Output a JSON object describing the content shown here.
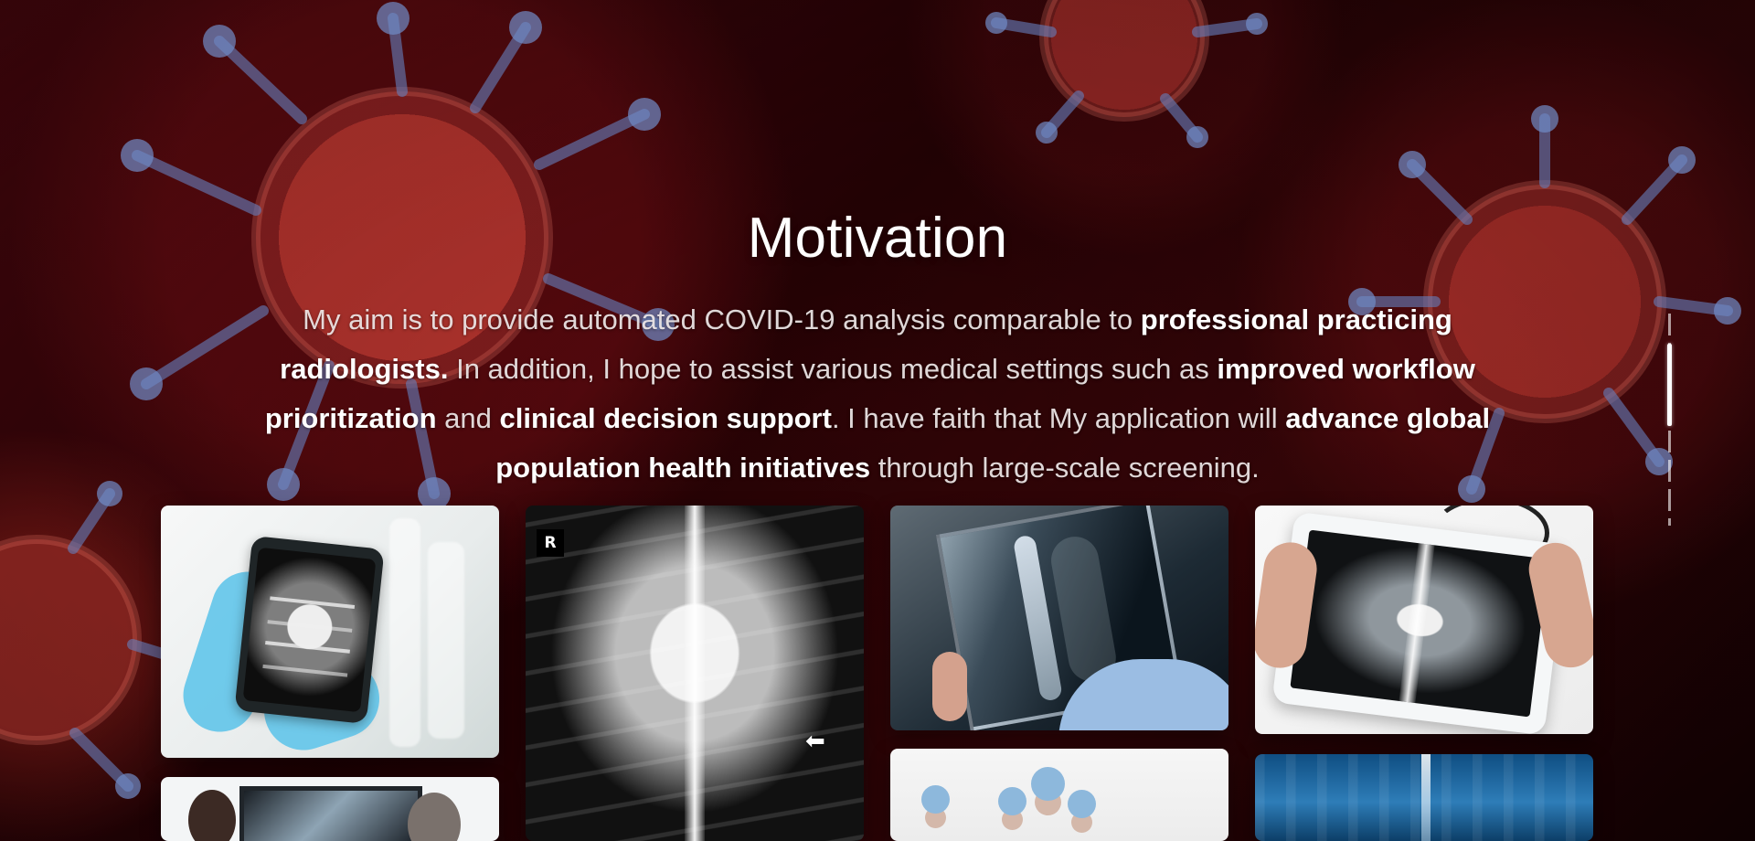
{
  "motivation": {
    "title": "Motivation",
    "parts": [
      "My aim is to provide automated COVID-19 analysis comparable to ",
      "professional practicing radiologists.",
      " In addition, I hope to assist various medical settings such as ",
      "improved workflow prioritization",
      " and ",
      "clinical decision support",
      ". I have faith that My application will ",
      "advance global population health initiatives",
      " through large-scale screening."
    ]
  },
  "gallery": {
    "chest_xray_marker": "R",
    "chest_xray_arrow": "⬅"
  }
}
